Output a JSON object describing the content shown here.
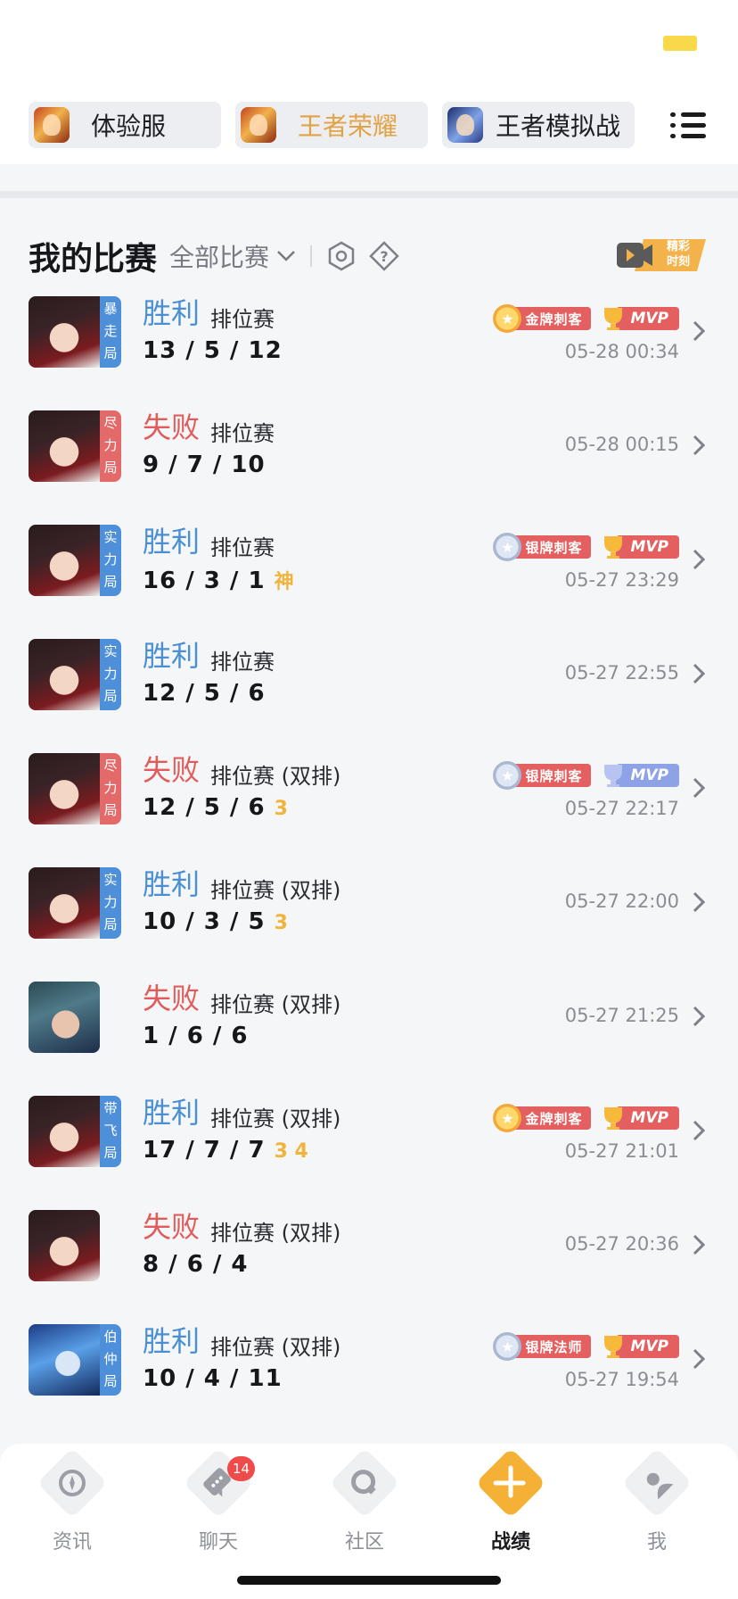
{
  "game_tabs": [
    {
      "label": "体验服",
      "icon": "honor-of-kings-trial-icon",
      "active": false
    },
    {
      "label": "王者荣耀",
      "icon": "honor-of-kings-icon",
      "active": true
    },
    {
      "label": "王者模拟战",
      "icon": "auto-chess-icon",
      "active": false
    }
  ],
  "section": {
    "title": "我的比赛",
    "filter": "全部比赛"
  },
  "highlight_button": {
    "line1": "精彩",
    "line2": "时刻"
  },
  "matches": [
    {
      "result": "胜利",
      "mode": "排位赛",
      "kda": "13 / 5 / 12",
      "extra": "",
      "time": "05-28 00:34",
      "tag": "暴走局",
      "medal": "金牌刺客",
      "mvp": "MVP"
    },
    {
      "result": "失败",
      "mode": "排位赛",
      "kda": "9 / 7 / 10",
      "extra": "",
      "time": "05-28 00:15",
      "tag": "尽力局"
    },
    {
      "result": "胜利",
      "mode": "排位赛",
      "kda": "16 / 3 / 1",
      "extra": "神",
      "time": "05-27 23:29",
      "tag": "实力局",
      "medal": "银牌刺客",
      "mvp": "MVP"
    },
    {
      "result": "胜利",
      "mode": "排位赛",
      "kda": "12 / 5 / 6",
      "extra": "",
      "time": "05-27 22:55",
      "tag": "实力局"
    },
    {
      "result": "失败",
      "mode": "排位赛 (双排)",
      "kda": "12 / 5 / 6",
      "extra": "3",
      "time": "05-27 22:17",
      "tag": "尽力局",
      "medal": "银牌刺客",
      "mvp": "MVP"
    },
    {
      "result": "胜利",
      "mode": "排位赛 (双排)",
      "kda": "10 / 3 / 5",
      "extra": "3",
      "time": "05-27 22:00",
      "tag": "实力局"
    },
    {
      "result": "失败",
      "mode": "排位赛 (双排)",
      "kda": "1 / 6 / 6",
      "extra": "",
      "time": "05-27 21:25",
      "tag": ""
    },
    {
      "result": "胜利",
      "mode": "排位赛 (双排)",
      "kda": "17 / 7 / 7",
      "extra": "3 4",
      "time": "05-27 21:01",
      "tag": "带飞局",
      "medal": "金牌刺客",
      "mvp": "MVP"
    },
    {
      "result": "失败",
      "mode": "排位赛 (双排)",
      "kda": "8 / 6 / 4",
      "extra": "",
      "time": "05-27 20:36",
      "tag": ""
    },
    {
      "result": "胜利",
      "mode": "排位赛 (双排)",
      "kda": "10 / 4 / 11",
      "extra": "",
      "time": "05-27 19:54",
      "tag": "伯仲局",
      "medal": "银牌法师",
      "mvp": "MVP"
    }
  ],
  "nav": [
    {
      "label": "资讯",
      "icon": "news-icon"
    },
    {
      "label": "聊天",
      "icon": "chat-icon",
      "badge": "14"
    },
    {
      "label": "社区",
      "icon": "community-icon"
    },
    {
      "label": "战绩",
      "icon": "battle-record-icon",
      "active": true
    },
    {
      "label": "我",
      "icon": "profile-icon"
    }
  ],
  "colors": {
    "win": "#4a8fd4",
    "lose": "#e25b5b",
    "accent": "#f5b136",
    "badge_red": "#e45f5f"
  }
}
